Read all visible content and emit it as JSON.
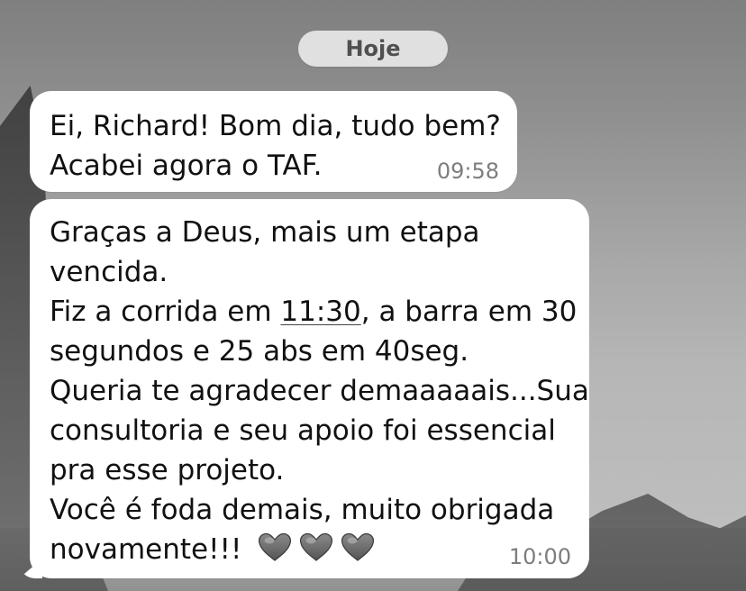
{
  "chat": {
    "date_label": "Hoje",
    "messages": [
      {
        "lines": [
          "Ei, Richard! Bom dia, tudo bem?",
          "Acabei agora o TAF."
        ],
        "time": "09:58"
      },
      {
        "lines": {
          "line_1": "Graças a Deus, mais um etapa",
          "line_2": "vencida.",
          "line_3_prefix": "Fiz a corrida em ",
          "line_3_time": "11:30",
          "line_3_suffix": ", a barra em 30",
          "line_4": "segundos e 25 abs em 40seg.",
          "line_5": "Queria te agradecer demaaaaais...Sua",
          "line_6": "consultoria e seu apoio foi essencial",
          "line_7": "pra esse projeto.",
          "line_8": "Você é foda demais, muito obrigada",
          "line_9": "novamente!!!"
        },
        "time": "10:00",
        "emoji_icons": [
          "gray-heart-icon",
          "gray-heart-icon",
          "gray-heart-icon"
        ]
      }
    ]
  },
  "colors": {
    "bubble": "#ffffff",
    "text": "#111111",
    "timestamp": "#7d7d7d",
    "date_pill": "#e5e5e5"
  }
}
